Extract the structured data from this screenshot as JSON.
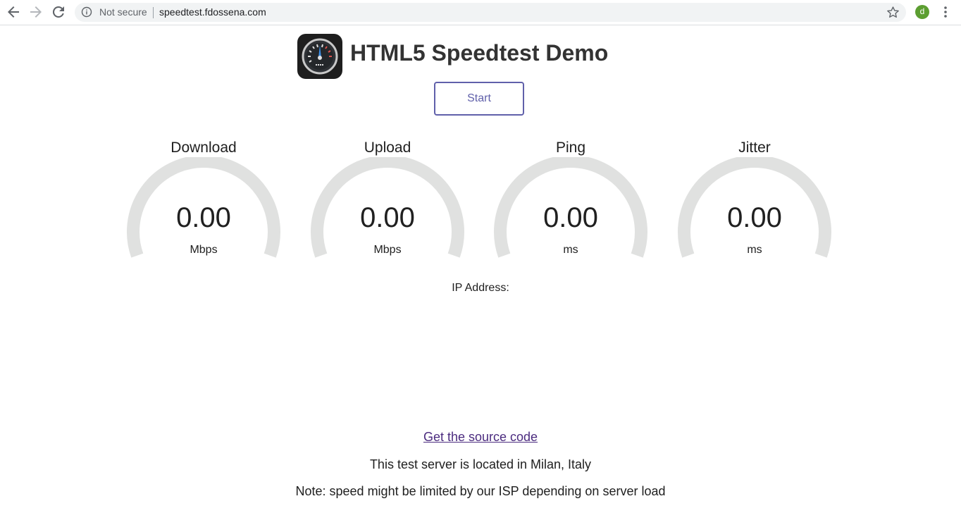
{
  "browser": {
    "security_label": "Not secure",
    "url": "speedtest.fdossena.com",
    "avatar_letter": "d",
    "icons": [
      "back-arrow-icon",
      "forward-arrow-icon",
      "reload-icon",
      "info-icon",
      "star-icon",
      "menu-dots-icon"
    ],
    "avatar_color": "#5c9e31"
  },
  "header": {
    "title": "HTML5 Speedtest Demo",
    "logo_icon": "speedometer-icon"
  },
  "controls": {
    "start_label": "Start",
    "accent_color": "#6060aa"
  },
  "meters": [
    {
      "title": "Download",
      "value": "0.00",
      "unit": "Mbps",
      "fill": 0
    },
    {
      "title": "Upload",
      "value": "0.00",
      "unit": "Mbps",
      "fill": 0
    },
    {
      "title": "Ping",
      "value": "0.00",
      "unit": "ms",
      "fill": 0
    },
    {
      "title": "Jitter",
      "value": "0.00",
      "unit": "ms",
      "fill": 0
    }
  ],
  "gauge_track_color": "#e0e1e0",
  "ip": {
    "label": "IP Address:",
    "value": ""
  },
  "footer": {
    "source_link": "Get the source code",
    "server_location": "This test server is located in Milan, Italy",
    "note": "Note: speed might be limited by our ISP depending on server load",
    "link_color": "#4b2b7f"
  }
}
